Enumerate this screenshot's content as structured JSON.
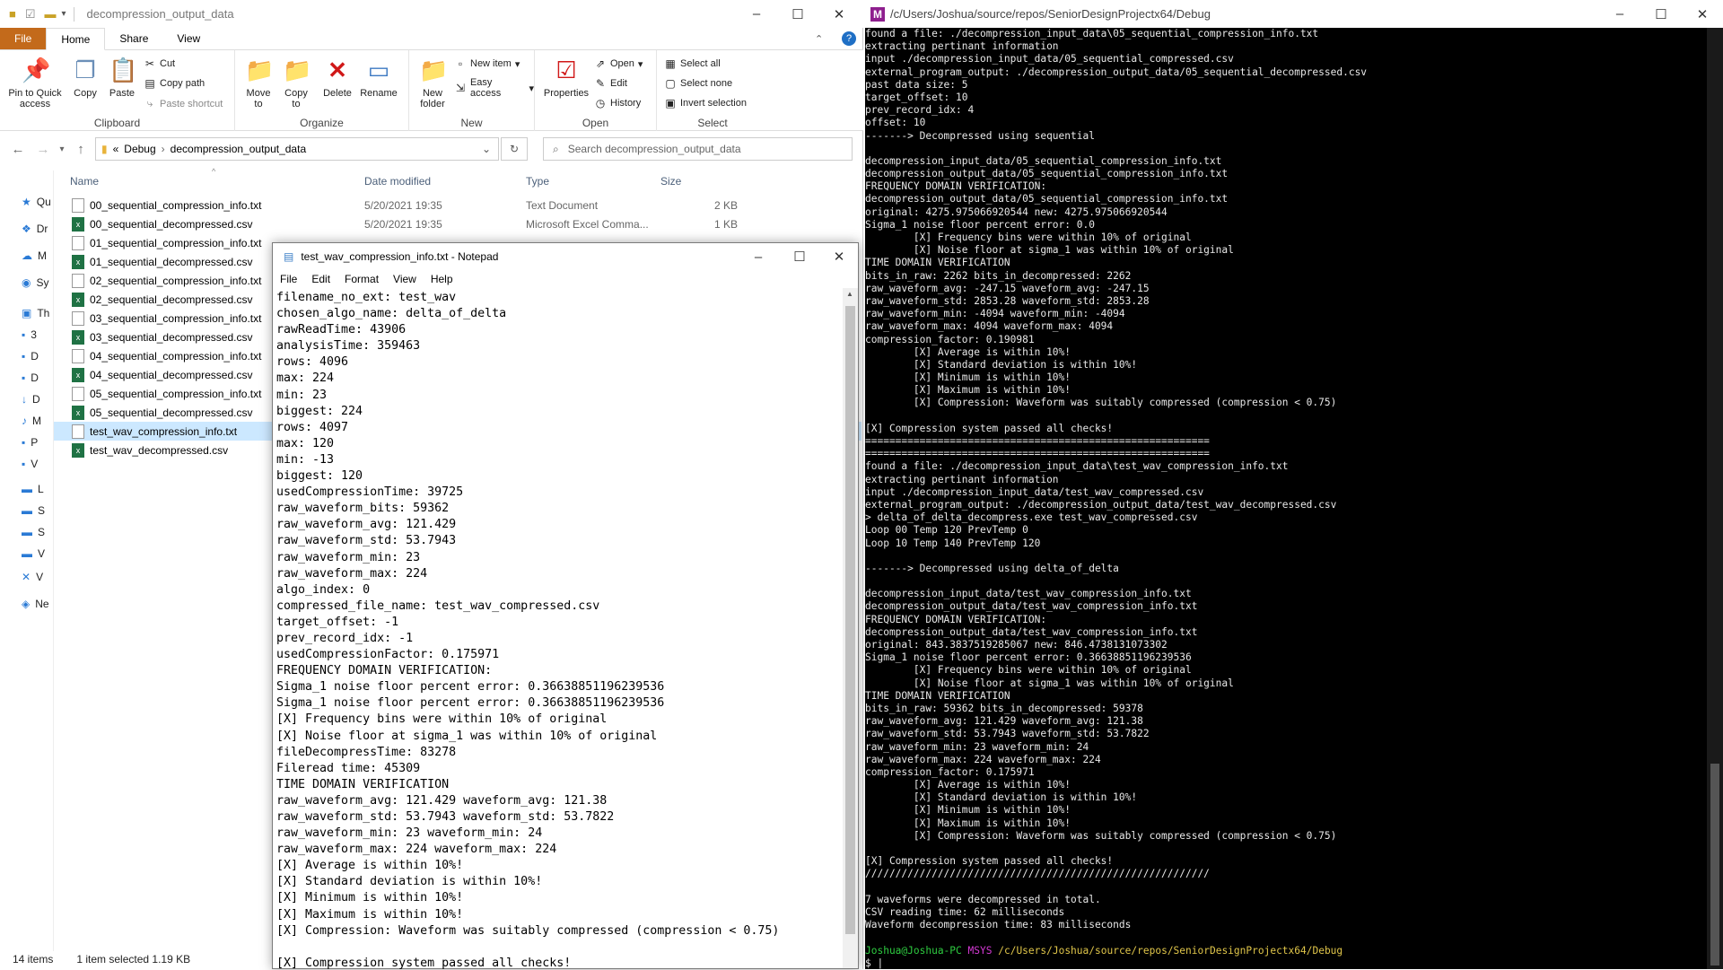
{
  "explorer": {
    "title": "decompression_output_data",
    "tabs": [
      "File",
      "Home",
      "Share",
      "View"
    ],
    "ribbon": {
      "clipboard": {
        "label": "Clipboard",
        "pin": "Pin to Quick access",
        "copy": "Copy",
        "paste": "Paste",
        "cut": "Cut",
        "copy_path": "Copy path",
        "paste_shortcut": "Paste shortcut"
      },
      "organize": {
        "label": "Organize",
        "move_to": "Move to",
        "copy_to": "Copy to",
        "delete": "Delete",
        "rename": "Rename"
      },
      "new": {
        "label": "New",
        "new_folder": "New folder",
        "new_item": "New item",
        "easy_access": "Easy access"
      },
      "open": {
        "label": "Open",
        "properties": "Properties",
        "open": "Open",
        "edit": "Edit",
        "history": "History"
      },
      "select": {
        "label": "Select",
        "select_all": "Select all",
        "select_none": "Select none",
        "invert": "Invert selection"
      }
    },
    "breadcrumb": {
      "root": "«",
      "part1": "Debug",
      "part2": "decompression_output_data"
    },
    "search_placeholder": "Search decompression_output_data",
    "columns": {
      "name": "Name",
      "date": "Date modified",
      "type": "Type",
      "size": "Size"
    },
    "nav_items": [
      "Qu",
      "Dr",
      "M",
      "Sy",
      "Th",
      "3",
      "D",
      "D",
      "D",
      "M",
      "P",
      "V",
      "L",
      "S",
      "S",
      "V",
      "V",
      "Ne"
    ],
    "files": [
      {
        "name": "00_sequential_compression_info.txt",
        "date": "5/20/2021 19:35",
        "type": "Text Document",
        "size": "2 KB",
        "kind": "txt"
      },
      {
        "name": "00_sequential_decompressed.csv",
        "date": "5/20/2021 19:35",
        "type": "Microsoft Excel Comma...",
        "size": "1 KB",
        "kind": "csv"
      },
      {
        "name": "01_sequential_compression_info.txt",
        "date": "",
        "type": "",
        "size": "",
        "kind": "txt"
      },
      {
        "name": "01_sequential_decompressed.csv",
        "date": "",
        "type": "",
        "size": "",
        "kind": "csv"
      },
      {
        "name": "02_sequential_compression_info.txt",
        "date": "",
        "type": "",
        "size": "",
        "kind": "txt"
      },
      {
        "name": "02_sequential_decompressed.csv",
        "date": "",
        "type": "",
        "size": "",
        "kind": "csv"
      },
      {
        "name": "03_sequential_compression_info.txt",
        "date": "",
        "type": "",
        "size": "",
        "kind": "txt"
      },
      {
        "name": "03_sequential_decompressed.csv",
        "date": "",
        "type": "",
        "size": "",
        "kind": "csv"
      },
      {
        "name": "04_sequential_compression_info.txt",
        "date": "",
        "type": "",
        "size": "",
        "kind": "txt"
      },
      {
        "name": "04_sequential_decompressed.csv",
        "date": "",
        "type": "",
        "size": "",
        "kind": "csv"
      },
      {
        "name": "05_sequential_compression_info.txt",
        "date": "",
        "type": "",
        "size": "",
        "kind": "txt"
      },
      {
        "name": "05_sequential_decompressed.csv",
        "date": "",
        "type": "",
        "size": "",
        "kind": "csv"
      },
      {
        "name": "test_wav_compression_info.txt",
        "date": "",
        "type": "",
        "size": "",
        "kind": "txt",
        "selected": true
      },
      {
        "name": "test_wav_decompressed.csv",
        "date": "",
        "type": "",
        "size": "",
        "kind": "csv"
      }
    ],
    "status": {
      "items": "14 items",
      "selected": "1 item selected  1.19 KB"
    }
  },
  "notepad": {
    "title": "test_wav_compression_info.txt - Notepad",
    "menu": [
      "File",
      "Edit",
      "Format",
      "View",
      "Help"
    ],
    "lines": [
      "filename_no_ext: test_wav",
      "chosen_algo_name: delta_of_delta",
      "rawReadTime: 43906",
      "analysisTime: 359463",
      "rows: 4096",
      "max: 224",
      "min: 23",
      "biggest: 224",
      "rows: 4097",
      "max: 120",
      "min: -13",
      "biggest: 120",
      "usedCompressionTime: 39725",
      "raw_waveform_bits: 59362",
      "raw_waveform_avg: 121.429",
      "raw_waveform_std: 53.7943",
      "raw_waveform_min: 23",
      "raw_waveform_max: 224",
      "algo_index: 0",
      "compressed_file_name: test_wav_compressed.csv",
      "target_offset: -1",
      "prev_record_idx: -1",
      "usedCompressionFactor: 0.175971",
      "FREQUENCY DOMAIN VERIFICATION:",
      "Sigma_1 noise floor percent error: 0.36638851196239536",
      "Sigma_1 noise floor percent error: 0.36638851196239536",
      "[X] Frequency bins were within 10% of original",
      "[X] Noise floor at sigma_1 was within 10% of original",
      "fileDecompressTime: 83278",
      "Fileread time: 45309",
      "TIME DOMAIN VERIFICATION",
      "raw_waveform_avg: 121.429 waveform_avg: 121.38",
      "raw_waveform_std: 53.7943 waveform_std: 53.7822",
      "raw_waveform_min: 23 waveform_min: 24",
      "raw_waveform_max: 224 waveform_max: 224",
      "[X] Average is within 10%!",
      "[X] Standard deviation is within 10%!",
      "[X] Minimum is within 10%!",
      "[X] Maximum is within 10%!",
      "[X] Compression: Waveform was suitably compressed (compression < 0.75)",
      "",
      "[X] Compression system passed all checks!"
    ]
  },
  "terminal": {
    "title": "/c/Users/Joshua/source/repos/SeniorDesignProjectx64/Debug",
    "lines": [
      "found a file: ./decompression_input_data\\05_sequential_compression_info.txt",
      "extracting pertinant information",
      "input ./decompression_input_data/05_sequential_compressed.csv",
      "external_program_output: ./decompression_output_data/05_sequential_decompressed.csv",
      "past data size: 5",
      "target_offset: 10",
      "prev_record_idx: 4",
      "offset: 10",
      "-------> Decompressed using sequential",
      "",
      "decompression_input_data/05_sequential_compression_info.txt",
      "decompression_output_data/05_sequential_compression_info.txt",
      "FREQUENCY DOMAIN VERIFICATION:",
      "decompression_output_data/05_sequential_compression_info.txt",
      "original: 4275.975066920544 new: 4275.975066920544",
      "Sigma_1 noise floor percent error: 0.0",
      "        [X] Frequency bins were within 10% of original",
      "        [X] Noise floor at sigma_1 was within 10% of original",
      "TIME DOMAIN VERIFICATION",
      "bits_in_raw: 2262 bits_in_decompressed: 2262",
      "raw_waveform_avg: -247.15 waveform_avg: -247.15",
      "raw_waveform_std: 2853.28 waveform_std: 2853.28",
      "raw_waveform_min: -4094 waveform_min: -4094",
      "raw_waveform_max: 4094 waveform_max: 4094",
      "compression_factor: 0.190981",
      "        [X] Average is within 10%!",
      "        [X] Standard deviation is within 10%!",
      "        [X] Minimum is within 10%!",
      "        [X] Maximum is within 10%!",
      "        [X] Compression: Waveform was suitably compressed (compression < 0.75)",
      "",
      "[X] Compression system passed all checks!",
      "=========================================================",
      "=========================================================",
      "found a file: ./decompression_input_data\\test_wav_compression_info.txt",
      "extracting pertinant information",
      "input ./decompression_input_data/test_wav_compressed.csv",
      "external_program_output: ./decompression_output_data/test_wav_decompressed.csv",
      "> delta_of_delta_decompress.exe test_wav_compressed.csv",
      "Loop 00 Temp 120 PrevTemp 0",
      "Loop 10 Temp 140 PrevTemp 120",
      "",
      "-------> Decompressed using delta_of_delta",
      "",
      "decompression_input_data/test_wav_compression_info.txt",
      "decompression_output_data/test_wav_compression_info.txt",
      "FREQUENCY DOMAIN VERIFICATION:",
      "decompression_output_data/test_wav_compression_info.txt",
      "original: 843.3837519285067 new: 846.4738131073302",
      "Sigma_1 noise floor percent error: 0.36638851196239536",
      "        [X] Frequency bins were within 10% of original",
      "        [X] Noise floor at sigma_1 was within 10% of original",
      "TIME DOMAIN VERIFICATION",
      "bits_in_raw: 59362 bits_in_decompressed: 59378",
      "raw_waveform_avg: 121.429 waveform_avg: 121.38",
      "raw_waveform_std: 53.7943 waveform_std: 53.7822",
      "raw_waveform_min: 23 waveform_min: 24",
      "raw_waveform_max: 224 waveform_max: 224",
      "compression_factor: 0.175971",
      "        [X] Average is within 10%!",
      "        [X] Standard deviation is within 10%!",
      "        [X] Minimum is within 10%!",
      "        [X] Maximum is within 10%!",
      "        [X] Compression: Waveform was suitably compressed (compression < 0.75)",
      "",
      "[X] Compression system passed all checks!",
      "/////////////////////////////////////////////////////////",
      "",
      "7 waveforms were decompressed in total.",
      "CSV reading time: 62 milliseconds",
      "Waveform decompression time: 83 milliseconds",
      ""
    ],
    "prompt": {
      "user": "Joshua@Joshua-PC",
      "sys": "MSYS",
      "path": "/c/Users/Joshua/source/repos/SeniorDesignProjectx64/Debug",
      "cursor": "$ |"
    }
  }
}
